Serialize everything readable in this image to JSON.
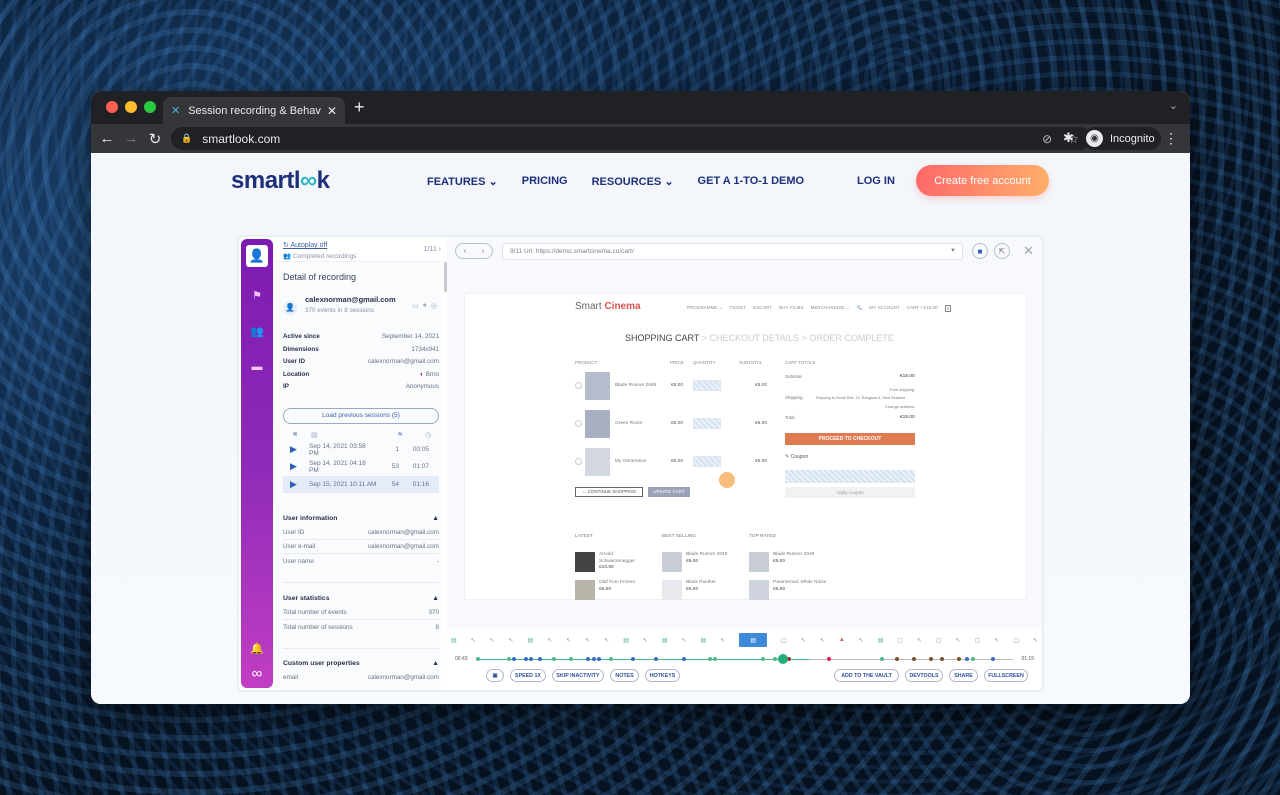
{
  "browser": {
    "tab_title": "Session recording & Behavior /",
    "url": "smartlook.com",
    "profile": "Incognito"
  },
  "site": {
    "logo_main": "smartl",
    "logo_accent": "∞",
    "logo_end": "k",
    "nav": [
      "FEATURES ⌄",
      "PRICING",
      "RESOURCES ⌄",
      "GET A 1-TO-1 DEMO"
    ],
    "login": "LOG IN",
    "cta": "Create free account"
  },
  "panel": {
    "autoplay": "Autoplay off",
    "completed": "Completed recordings",
    "counter": "1/11",
    "title": "Detail of recording",
    "user_email": "calexnorman@gmail.com",
    "user_sub": "370 events in 8 sessions",
    "details": [
      {
        "k": "Active since",
        "v": "September 14, 2021"
      },
      {
        "k": "Dimensions",
        "v": "1734x941"
      },
      {
        "k": "User ID",
        "v": "calexnorman@gmail.com"
      },
      {
        "k": "Location",
        "v": "Brno"
      },
      {
        "k": "IP",
        "v": "Anonymous"
      }
    ],
    "load_previous": "Load previous sessions (5)",
    "sessions": [
      {
        "date": "Sep 14, 2021  03:58 PM",
        "events": "1",
        "duration": "00:05"
      },
      {
        "date": "Sep 14, 2021  04:18 PM",
        "events": "53",
        "duration": "01:07"
      },
      {
        "date": "Sep 15, 2021  10:11 AM",
        "events": "54",
        "duration": "01:16"
      }
    ],
    "user_info_title": "User information",
    "user_info": [
      {
        "k": "User ID",
        "v": "calexnorman@gmail.com"
      },
      {
        "k": "User e-mail",
        "v": "calexnorman@gmail.com"
      },
      {
        "k": "User name",
        "v": "-"
      }
    ],
    "stats_title": "User statistics",
    "stats": [
      {
        "k": "Total number of events",
        "v": "370"
      },
      {
        "k": "Total number of sessions",
        "v": "8"
      }
    ],
    "custom_title": "Custom user properties",
    "custom": [
      {
        "k": "email",
        "v": "calexnorman@gmail.com"
      }
    ]
  },
  "player": {
    "url_text": "9/11 Url: https://demo.smartcinema.co/cart/",
    "time_start": "00:43",
    "time_end": "01:15",
    "tools_left": [
      "SPEED 1X",
      "SKIP INACTIVITY",
      "NOTES",
      "HOTKEYS"
    ],
    "tools_right": [
      "ADD TO THE VAULT",
      "DEVTOOLS",
      "SHARE",
      "FULLSCREEN"
    ]
  },
  "recorded_page": {
    "logo_a": "Smart ",
    "logo_b": "Cinema",
    "nav": [
      "PROGRAMME ⌄",
      "TICKET",
      "ESCORT",
      "BUY FILMS",
      "MERCHANDISE ⌄",
      "🔍",
      "MY ACCOUNT",
      "CART / €15.00"
    ],
    "crumb_active": "SHOPPING CART",
    "crumb_rest": " > CHECKOUT DETAILS > ORDER COMPLETE",
    "headers": {
      "product": "PRODUCT",
      "price": "PRICE",
      "quantity": "QUANTITY",
      "subtotal": "SUBTOTAL",
      "totals": "CART TOTALS"
    },
    "products": [
      {
        "name": "Blade Runner 2049",
        "price": "€5.00",
        "subtotal": "€5.00"
      },
      {
        "name": "Green Room",
        "price": "€5.00",
        "subtotal": "€5.00"
      },
      {
        "name": "My Generation",
        "price": "€5.00",
        "subtotal": "€5.00"
      }
    ],
    "continue": "← CONTINUE SHOPPING",
    "update": "UPDATE CART",
    "subtotal_label": "Subtotal",
    "subtotal_value": "€15.00",
    "shipping_label": "Shipping",
    "shipping_free": "Free shipping",
    "shipping_to": "Shipping to South Bell, 12, Rangiora 4, New Zealand",
    "change_address": "Change address",
    "total_label": "Total",
    "total_value": "€15.00",
    "checkout": "PROCEED TO CHECKOUT",
    "coupon": "Coupon",
    "apply": "Apply coupon",
    "widgets": [
      {
        "title": "LATEST",
        "items": [
          {
            "name": "Arnold Schwarzenegger",
            "price": "€10.00"
          },
          {
            "name": "Olaf from Frozen",
            "price": "€6.00"
          }
        ]
      },
      {
        "title": "BEST SELLING",
        "items": [
          {
            "name": "Blade Runner 2049",
            "price": "€5.00"
          },
          {
            "name": "Black Panther",
            "price": "€5.00"
          }
        ]
      },
      {
        "title": "TOP RATED",
        "items": [
          {
            "name": "Blade Runner 2049",
            "price": "€5.00"
          },
          {
            "name": "Paranormal: White Noise",
            "price": "€5.00"
          }
        ]
      }
    ]
  }
}
